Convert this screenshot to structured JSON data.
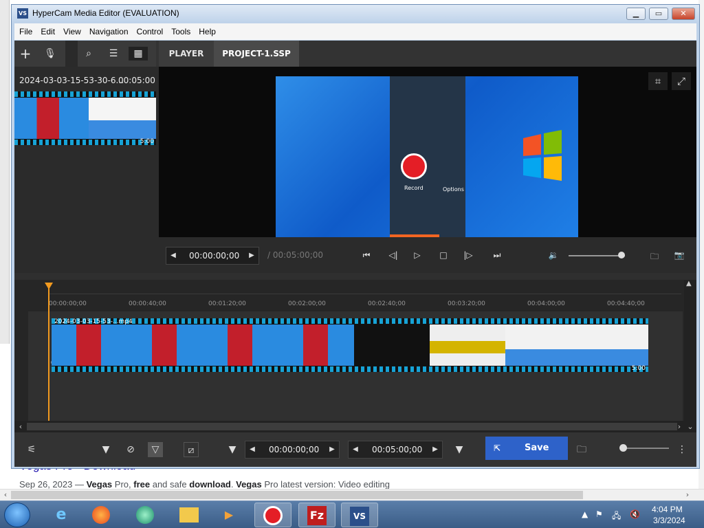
{
  "window": {
    "title": "HyperCam Media Editor  (EVALUATION)",
    "icon_label": "VS"
  },
  "menu": [
    "File",
    "Edit",
    "View",
    "Navigation",
    "Control",
    "Tools",
    "Help"
  ],
  "media_bin": {
    "clip_name": "2024-03-03-15-53-30-6...",
    "clip_duration": "00:05:00",
    "thumb_duration": "5:00"
  },
  "tabs": [
    {
      "label": "PLAYER",
      "active": false
    },
    {
      "label": "PROJECT-1.SSP",
      "active": true
    }
  ],
  "player": {
    "current_time": "00:00:00;00",
    "total_time": "/ 00:05:00;00",
    "video_overlay": {
      "record_label": "Record",
      "options_label": "Options"
    }
  },
  "timeline": {
    "ticks": [
      "00:00:00;00",
      "00:00:40;00",
      "00:01:20;00",
      "00:02:00;00",
      "00:02:40;00",
      "00:03:20;00",
      "00:04:00;00",
      "00:04:40;00"
    ],
    "clip_name": "2024-03-03-15-53-...mp4",
    "clip_duration": "5:00"
  },
  "bottom_bar": {
    "start_time": "00:00:00;00",
    "end_time": "00:05:00;00",
    "save_label": "Save"
  },
  "background_page": {
    "headline": "Vegas Pro - Download",
    "snippet_date": "Sep 26, 2023 — ",
    "snippet_parts": [
      "Vegas",
      " Pro, ",
      "free",
      " and safe ",
      "download",
      ". ",
      "Vegas",
      " Pro latest version: Video editing"
    ]
  },
  "taskbar": {
    "clock_time": "4:04 PM",
    "clock_date": "3/3/2024",
    "apps": [
      "internet-explorer",
      "firefox",
      "app-green",
      "file-explorer",
      "media-player",
      "hypercam-record",
      "filezilla",
      "hypercam-editor"
    ]
  },
  "colors": {
    "accent_blue": "#2e62c9",
    "playhead_orange": "#f29a1f",
    "film_cyan": "#17a3d6",
    "record_red": "#e41e26"
  }
}
